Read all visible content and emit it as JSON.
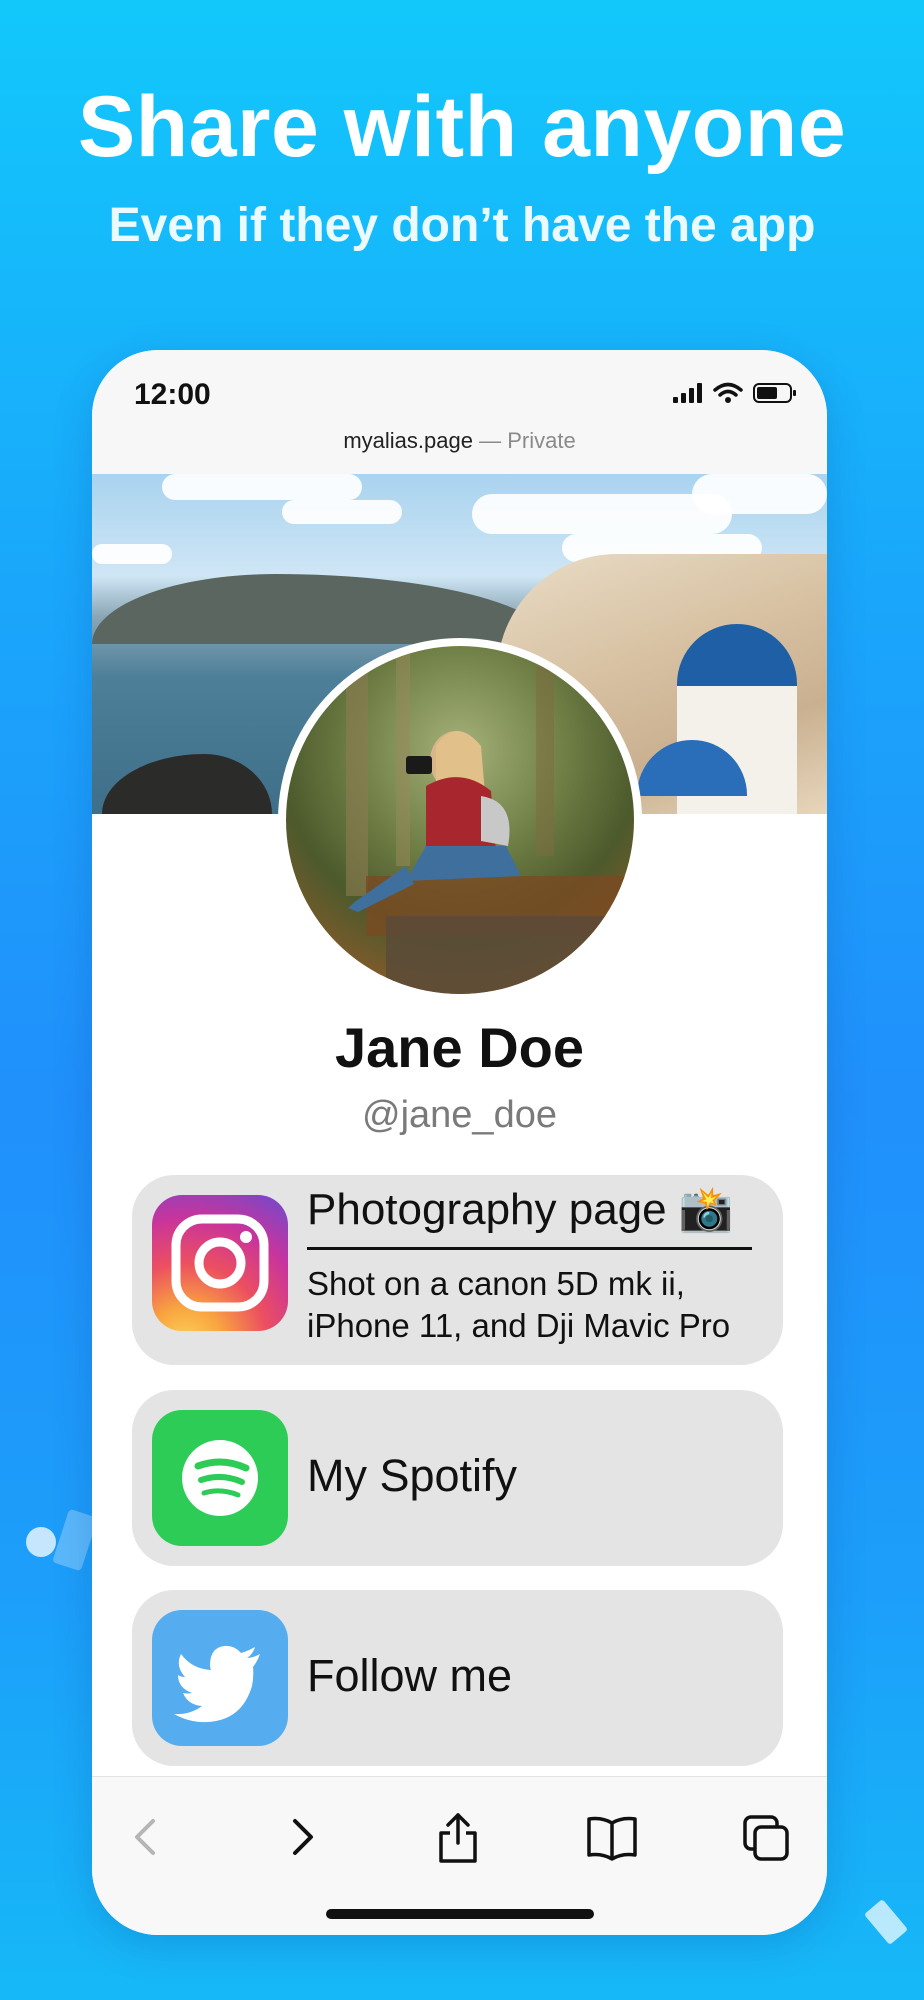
{
  "promo": {
    "headline": "Share with anyone",
    "subheadline": "Even if they don’t have the app"
  },
  "status_bar": {
    "time": "12:00",
    "icons": [
      "signal-icon",
      "wifi-icon",
      "battery-icon"
    ]
  },
  "browser": {
    "url": "myalias.page",
    "separator": "—",
    "mode": "Private"
  },
  "profile": {
    "name": "Jane Doe",
    "handle": "@jane_doe"
  },
  "links": [
    {
      "icon": "instagram-icon",
      "title": "Photography page 📸",
      "description": "Shot on a canon 5D mk ii, iPhone 11, and Dji Mavic Pro"
    },
    {
      "icon": "spotify-icon",
      "label": "My Spotify"
    },
    {
      "icon": "twitter-icon",
      "label": "Follow me"
    }
  ],
  "toolbar": {
    "buttons": [
      "back-icon",
      "forward-icon",
      "share-icon",
      "bookmarks-icon",
      "tabs-icon"
    ]
  },
  "colors": {
    "background_top": "#12c8fb",
    "background_mid": "#2090fb",
    "card_bg": "#e4e4e4",
    "spotify_green": "#2ccc57",
    "twitter_blue": "#55acee"
  }
}
